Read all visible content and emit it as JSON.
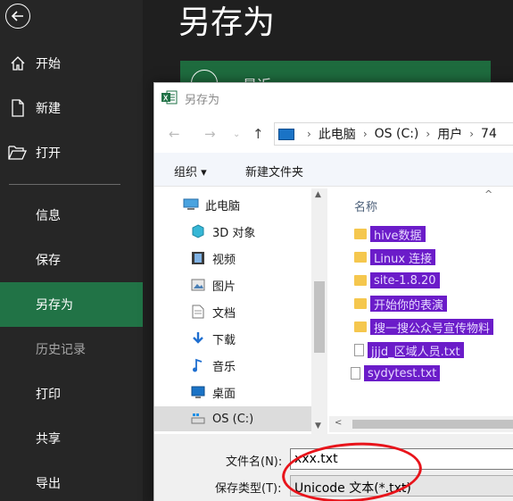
{
  "backstage": {
    "title": "另存为",
    "nav": [
      {
        "label": "开始",
        "icon": "home-icon"
      },
      {
        "label": "新建",
        "icon": "new-document-icon"
      },
      {
        "label": "打开",
        "icon": "open-folder-icon"
      },
      {
        "label": "信息"
      },
      {
        "label": "保存"
      },
      {
        "label": "另存为",
        "active": true
      },
      {
        "label": "历史记录",
        "disabled": true
      },
      {
        "label": "打印"
      },
      {
        "label": "共享"
      },
      {
        "label": "导出"
      }
    ],
    "recent_label": "最近",
    "accent_color": "#217346"
  },
  "dialog": {
    "title": "另存为",
    "breadcrumb": [
      "此电脑",
      "OS (C:)",
      "用户",
      "74"
    ],
    "organize": "组织 ▾",
    "new_folder": "新建文件夹",
    "nav_tree": [
      {
        "label": "此电脑",
        "icon": "computer-icon"
      },
      {
        "label": "3D 对象",
        "icon": "3d-objects-icon"
      },
      {
        "label": "视频",
        "icon": "video-icon"
      },
      {
        "label": "图片",
        "icon": "picture-icon"
      },
      {
        "label": "文档",
        "icon": "document-icon"
      },
      {
        "label": "下载",
        "icon": "download-icon"
      },
      {
        "label": "音乐",
        "icon": "music-icon"
      },
      {
        "label": "桌面",
        "icon": "desktop-icon"
      },
      {
        "label": "OS (C:)",
        "icon": "drive-icon",
        "selected": true
      }
    ],
    "column_header": "名称",
    "files": [
      {
        "name": "hive数据",
        "type": "folder"
      },
      {
        "name": "Linux 连接",
        "type": "folder"
      },
      {
        "name": "site-1.8.20",
        "type": "folder"
      },
      {
        "name": "开始你的表演",
        "type": "folder"
      },
      {
        "name": "搜一搜公众号宣传物料",
        "type": "folder"
      },
      {
        "name": "jjjd_区域人员.txt",
        "type": "txt"
      },
      {
        "name": "sydytest.txt",
        "type": "txt"
      }
    ],
    "redaction_color": "#6b1cc9",
    "filename_label": "文件名(N):",
    "filename_value": "xxx.txt",
    "filetype_label": "保存类型(T):",
    "filetype_value": "Unicode 文本(*.txt)"
  }
}
